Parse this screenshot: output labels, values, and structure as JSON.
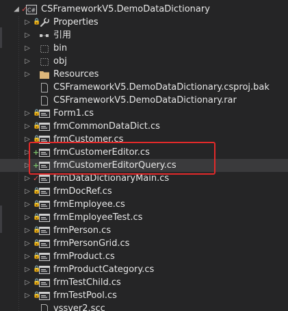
{
  "project": {
    "name": "CSFrameworkV5.DemoDataDictionary",
    "badge_icon": "csharp-project-icon"
  },
  "items": [
    {
      "label": "Properties",
      "icon": "wrench-icon",
      "expander": true,
      "badge": "lock"
    },
    {
      "label": "引用",
      "icon": "references-icon",
      "expander": true,
      "badge": ""
    },
    {
      "label": "bin",
      "icon": "dashed-folder-icon",
      "expander": true,
      "badge": ""
    },
    {
      "label": "obj",
      "icon": "dashed-folder-icon",
      "expander": true,
      "badge": ""
    },
    {
      "label": "Resources",
      "icon": "folder-icon",
      "expander": true,
      "badge": ""
    },
    {
      "label": "CSFrameworkV5.DemoDataDictionary.csproj.bak",
      "icon": "file-icon",
      "expander": false,
      "badge": ""
    },
    {
      "label": "CSFrameworkV5.DemoDataDictionary.rar",
      "icon": "file-icon",
      "expander": false,
      "badge": ""
    },
    {
      "label": "Form1.cs",
      "icon": "form-icon",
      "expander": true,
      "badge": "lock"
    },
    {
      "label": "frmCommonDataDict.cs",
      "icon": "form-icon",
      "expander": true,
      "badge": "lock"
    },
    {
      "label": "frmCustomer.cs",
      "icon": "form-icon",
      "expander": true,
      "badge": "lock"
    },
    {
      "label": "frmCustomerEditor.cs",
      "icon": "form-icon",
      "expander": true,
      "badge": "plus"
    },
    {
      "label": "frmCustomerEditorQuery.cs",
      "icon": "form-icon",
      "expander": true,
      "badge": "plus"
    },
    {
      "label": "frmDataDictionaryMain.cs",
      "icon": "form-icon",
      "expander": true,
      "badge": "check"
    },
    {
      "label": "frmDocRef.cs",
      "icon": "form-icon",
      "expander": true,
      "badge": "lock"
    },
    {
      "label": "frmEmployee.cs",
      "icon": "form-icon",
      "expander": true,
      "badge": "lock"
    },
    {
      "label": "frmEmployeeTest.cs",
      "icon": "form-icon",
      "expander": true,
      "badge": "lock"
    },
    {
      "label": "frmPerson.cs",
      "icon": "form-icon",
      "expander": true,
      "badge": "lock"
    },
    {
      "label": "frmPersonGrid.cs",
      "icon": "form-icon",
      "expander": true,
      "badge": "lock"
    },
    {
      "label": "frmProduct.cs",
      "icon": "form-icon",
      "expander": true,
      "badge": "lock"
    },
    {
      "label": "frmProductCategory.cs",
      "icon": "form-icon",
      "expander": true,
      "badge": "lock"
    },
    {
      "label": "frmTestChild.cs",
      "icon": "form-icon",
      "expander": true,
      "badge": "lock"
    },
    {
      "label": "frmTestPool.cs",
      "icon": "form-icon",
      "expander": true,
      "badge": "lock"
    },
    {
      "label": "vssver2.scc",
      "icon": "file-icon",
      "expander": false,
      "badge": ""
    }
  ],
  "selected_index": 11,
  "highlighted_items": [
    "frmCustomerEditor.cs",
    "frmCustomerEditorQuery.cs"
  ],
  "colors": {
    "background": "#252526",
    "selection": "#3a3a3c",
    "highlight_border": "#e32a2a",
    "lock_badge": "#4e9bd6",
    "plus_badge": "#7cc36b",
    "check_badge": "#e04e4e"
  }
}
